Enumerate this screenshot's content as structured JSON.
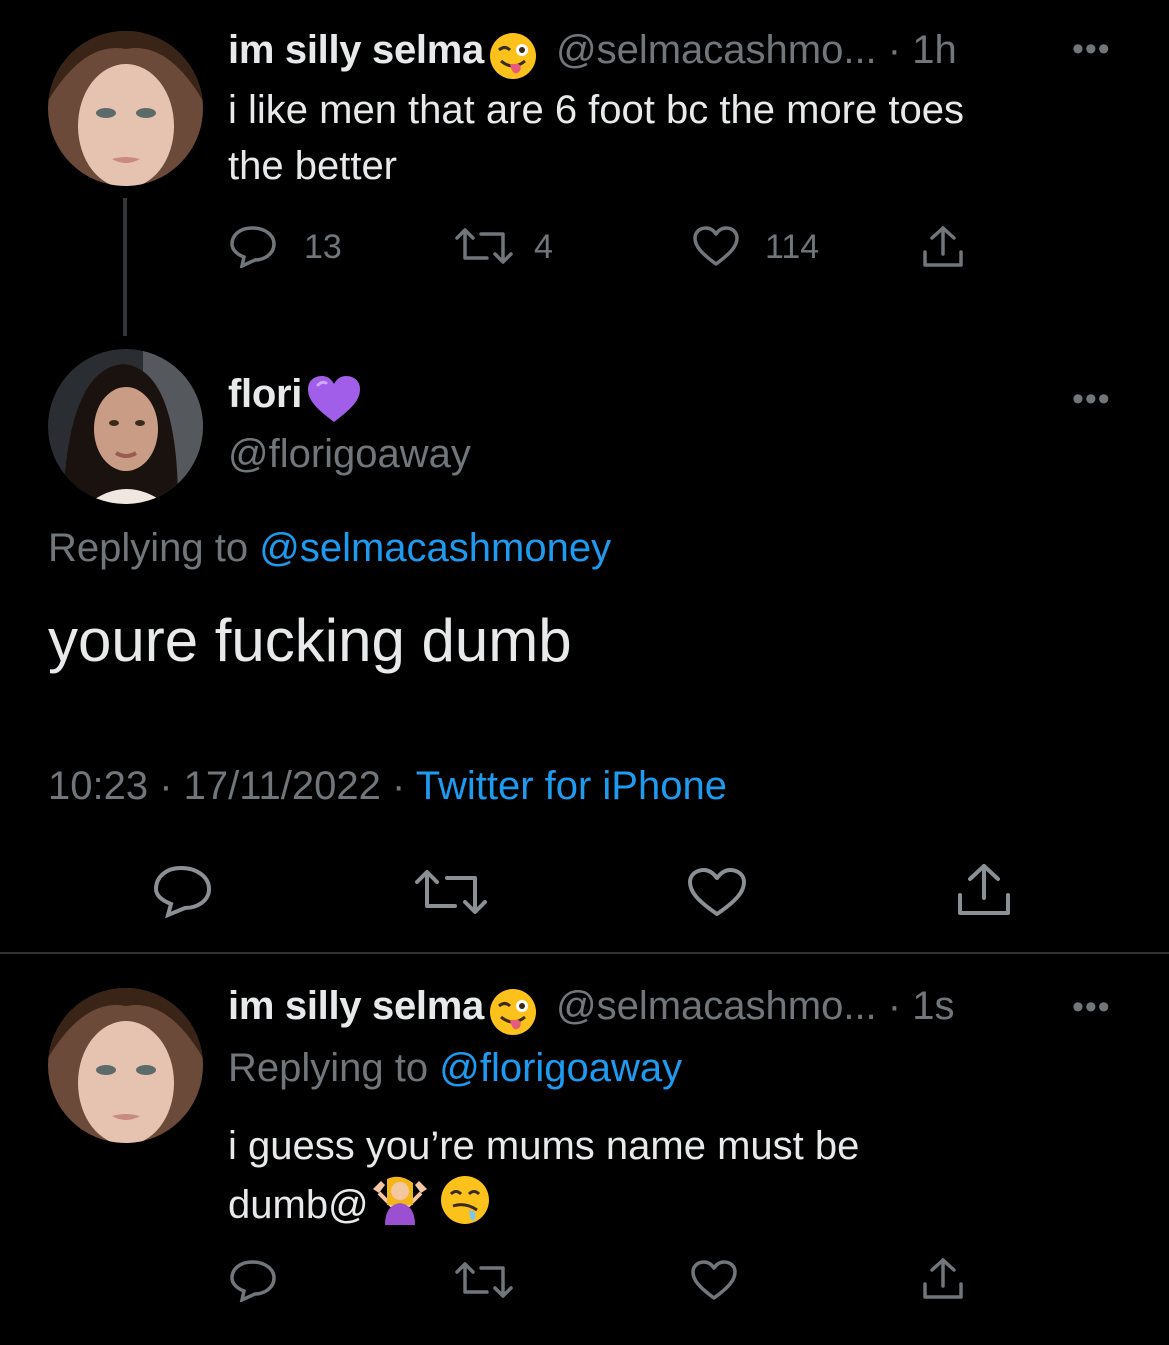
{
  "tweet1": {
    "display_name": "im silly selma",
    "handle_time": "@selmacashmo... · 1h",
    "text_line1": "i like men that are 6 foot bc the more toes",
    "text_line2": "the better",
    "reply_count": "13",
    "retweet_count": "4",
    "like_count": "114",
    "emoji": "winking-face-with-tongue"
  },
  "tweet2": {
    "display_name": "flori",
    "handle": "@florigoaway",
    "replying_prefix": "Replying to",
    "replying_to": "@selmacashmoney",
    "text": "youre fucking dumb",
    "time": "10:23",
    "date": "17/11/2022",
    "source": "Twitter for iPhone",
    "emoji": "purple-heart"
  },
  "tweet3": {
    "display_name": "im silly selma",
    "handle_time": "@selmacashmo... · 1s",
    "replying_prefix": "Replying to",
    "replying_to": "@florigoaway",
    "text_line1": "i guess you’re mums name must be",
    "text_line2": "dumb@",
    "emojis": [
      "person-shrugging",
      "drooling-face"
    ]
  },
  "more_label": "•••",
  "colors": {
    "background": "#000000",
    "primary_text": "#e7e9ea",
    "secondary_text": "#71767b",
    "link": "#1d9bf0",
    "divider": "#2f3336"
  }
}
